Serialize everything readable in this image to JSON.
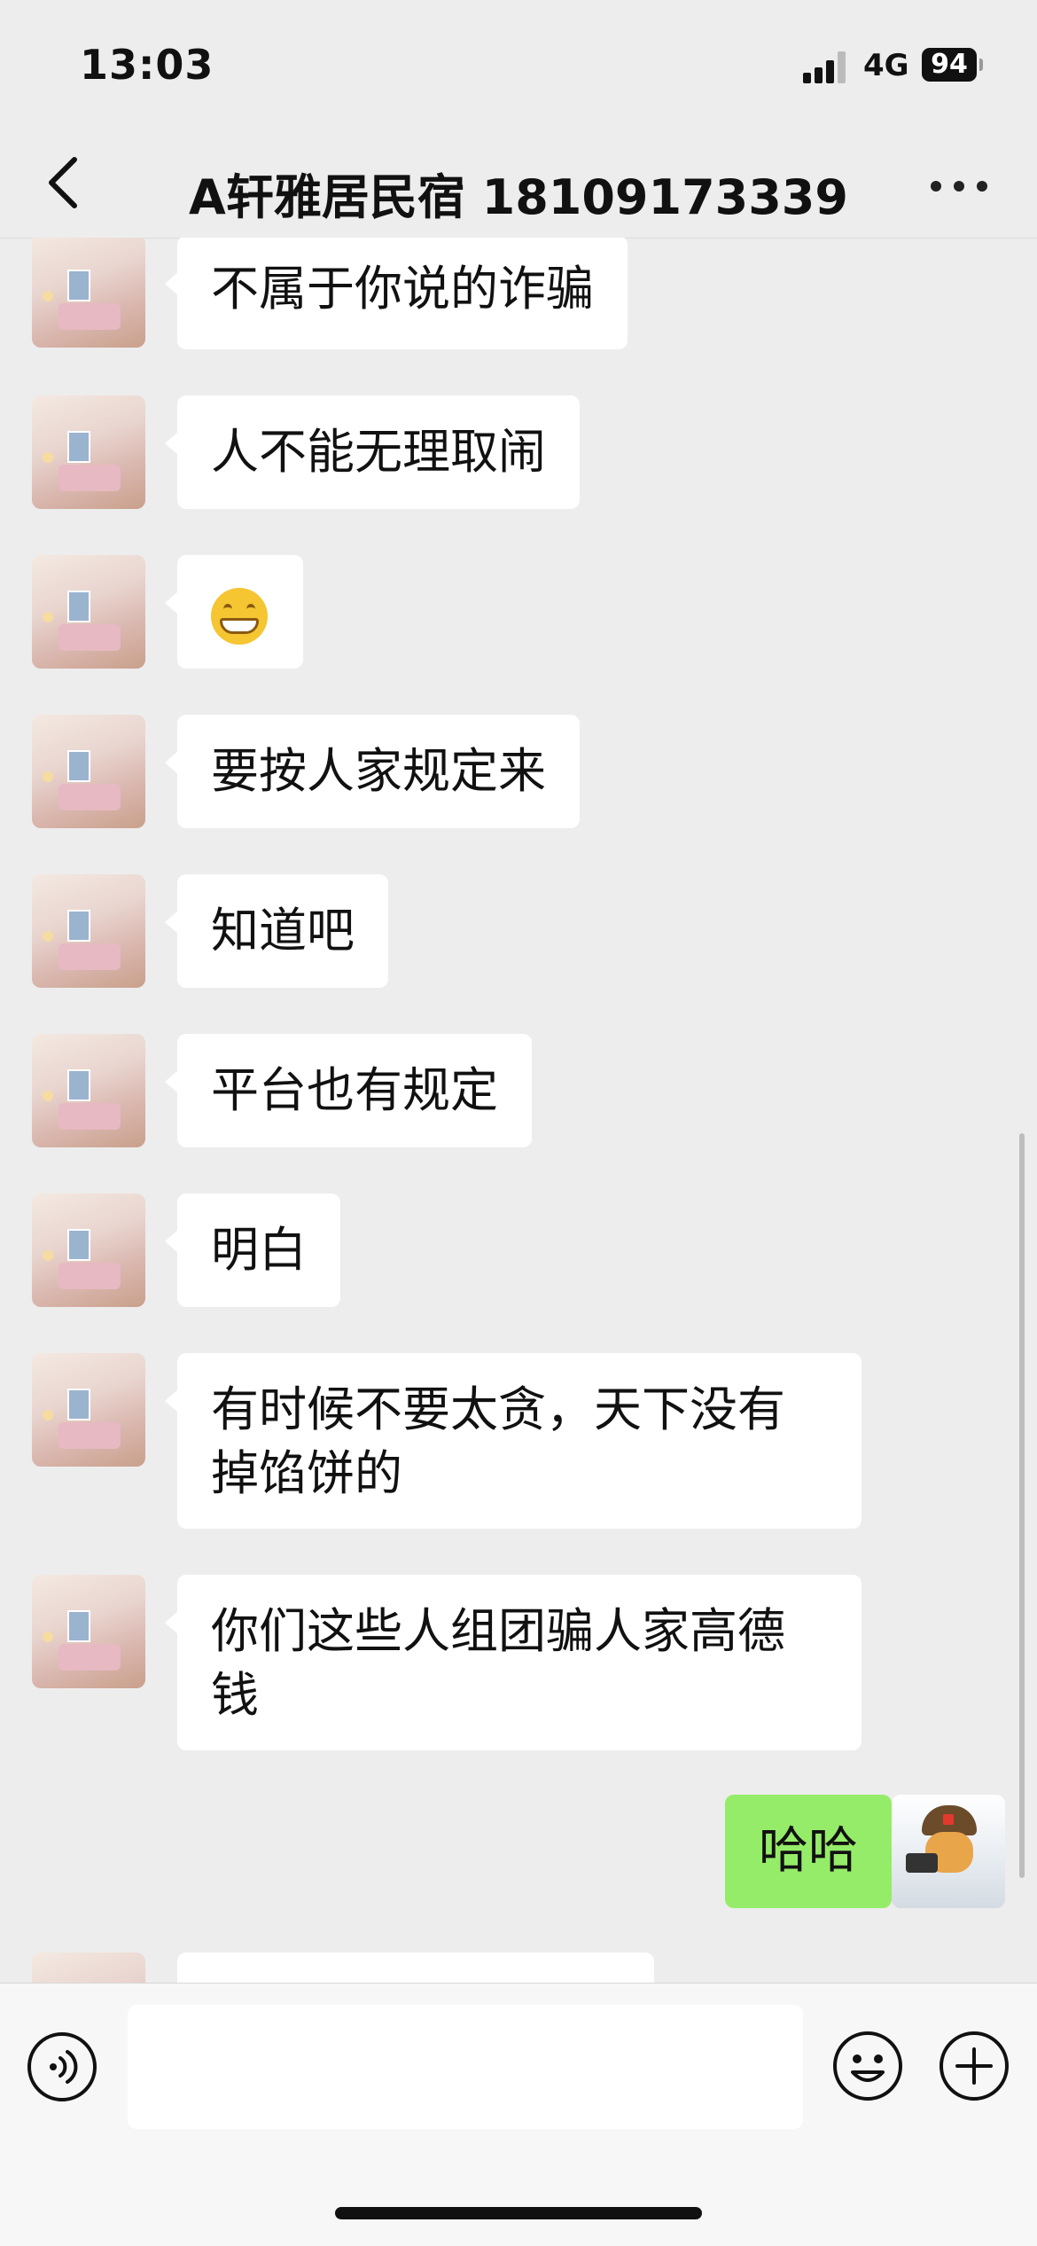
{
  "status_bar": {
    "time": "13:03",
    "network": "4G",
    "battery": "94"
  },
  "header": {
    "title": "A轩雅居民宿 18109173339"
  },
  "messages": [
    {
      "text": "不属于你说的诈骗"
    },
    {
      "text": "人不能无理取闹"
    },
    {
      "text": "",
      "emoji": "grinning-face-emoji"
    },
    {
      "text": "要按人家规定来"
    },
    {
      "text": "知道吧"
    },
    {
      "text": "平台也有规定"
    },
    {
      "text": "明白"
    },
    {
      "text": "有时候不要太贪，天下没有掉馅饼的"
    },
    {
      "text": "你们这些人组团骗人家高德钱"
    },
    {
      "text": "哈哈",
      "outgoing": true
    }
  ],
  "input": {
    "value": ""
  },
  "colors": {
    "background": "#ededed",
    "incoming_bubble": "#ffffff",
    "outgoing_bubble": "#95ec69"
  }
}
